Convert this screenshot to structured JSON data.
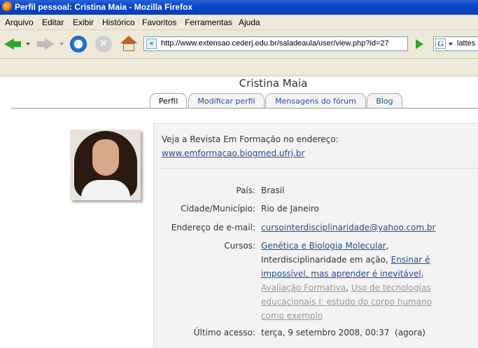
{
  "window": {
    "title": "Perfil pessoal: Cristina Maia - Mozilla Firefox"
  },
  "menu": [
    "Arquivo",
    "Editar",
    "Exibir",
    "Histórico",
    "Favoritos",
    "Ferramentas",
    "Ajuda"
  ],
  "toolbar": {
    "url": "http://www.extensao.cederj.edu.br/saladeaula/user/view.php?id=27",
    "search_value": "lattes",
    "stop_glyph": "✕",
    "search_engine_glyph": "G"
  },
  "profile": {
    "name": "Cristina Maia",
    "tabs": [
      "Perfil",
      "Modificar perfil",
      "Mensagens do fórum",
      "Blog"
    ],
    "description_text": "Veja a Revista Em Formação no endereço:",
    "description_link": "www.emformacao.biogmed.ufrj.br",
    "fields": {
      "country_label": "País:",
      "country": "Brasil",
      "city_label": "Cidade/Município:",
      "city": "Rio de Janeiro",
      "email_label": "Endereço de e-mail:",
      "email": "cursointerdisciplinaridade@yahoo.com.br",
      "courses_label": "Cursos:",
      "courses": [
        "Genética e Biologia Molecular",
        "Interdisciplinaridade em ação",
        "Ensinar é impossível, mas aprender é inevitável",
        "Avaliação Formativa",
        "Uso de tecnologias educacionais I: estudo do corpo humano como exemplo"
      ],
      "last_access_label": "Último acesso:",
      "last_access": "terça, 9 setembro 2008, 00:37  (agora)"
    }
  }
}
